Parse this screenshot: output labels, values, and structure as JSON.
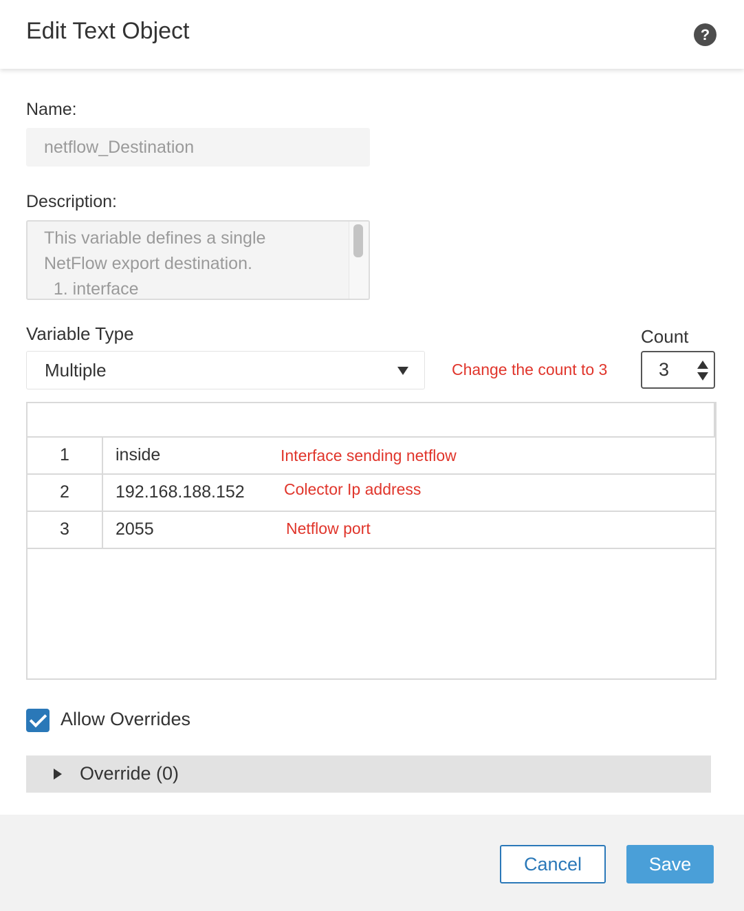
{
  "dialog": {
    "title": "Edit Text Object",
    "help_icon": "question-mark-icon"
  },
  "form": {
    "name_label": "Name:",
    "name_value": "netflow_Destination",
    "description_label": "Description:",
    "description_text": "This variable defines a single\nNetFlow export destination.\n  1. interface",
    "variable_type_label": "Variable Type",
    "variable_type_value": "Multiple",
    "count_label": "Count",
    "count_value": "3"
  },
  "annotations": {
    "count_note": "Change the count to 3",
    "row_notes": [
      "Interface sending netflow",
      "Colector Ip address",
      "Netflow port"
    ],
    "color": "#e0352b"
  },
  "table": {
    "rows": [
      {
        "index": "1",
        "value": "inside"
      },
      {
        "index": "2",
        "value": "192.168.188.152"
      },
      {
        "index": "3",
        "value": "2055"
      }
    ]
  },
  "overrides": {
    "allow_label": "Allow Overrides",
    "allow_checked": true,
    "section_label": "Override (0)"
  },
  "footer": {
    "cancel_label": "Cancel",
    "save_label": "Save"
  },
  "colors": {
    "accent": "#2a78b8",
    "primary_button": "#4a9fd8"
  }
}
